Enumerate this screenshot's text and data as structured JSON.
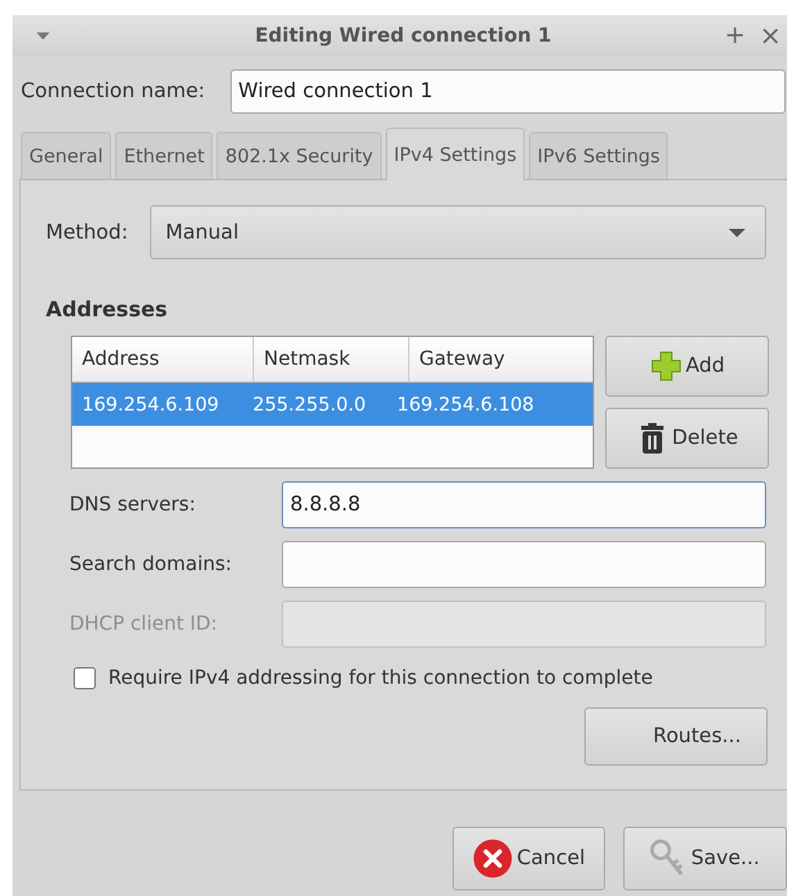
{
  "window": {
    "title": "Editing Wired connection 1",
    "controls": [
      {
        "kind": "maximize",
        "glyph": "+"
      },
      {
        "kind": "close",
        "glyph": "×"
      }
    ]
  },
  "connection_name": {
    "label": "Connection name:",
    "value": "Wired connection 1"
  },
  "tabs": [
    {
      "label": "General",
      "selected": false
    },
    {
      "label": "Ethernet",
      "selected": false
    },
    {
      "label": "802.1x Security",
      "selected": false
    },
    {
      "label": "IPv4 Settings",
      "selected": true
    },
    {
      "label": "IPv6 Settings",
      "selected": false
    }
  ],
  "method": {
    "label": "Method:",
    "value": "Manual"
  },
  "addresses": {
    "heading": "Addresses",
    "columns": [
      "Address",
      "Netmask",
      "Gateway"
    ],
    "rows": [
      {
        "cells": [
          "169.254.6.109",
          "255.255.0.0",
          "169.254.6.108"
        ],
        "selected": true
      }
    ],
    "buttons": [
      {
        "kind": "add",
        "label": "Add"
      },
      {
        "kind": "delete",
        "label": "Delete"
      }
    ]
  },
  "fields": [
    {
      "label": "DNS servers:",
      "value": "8.8.8.8",
      "disabled": false,
      "focused": true
    },
    {
      "label": "Search domains:",
      "disabled": false,
      "focused": false
    },
    {
      "label": "DHCP client ID:",
      "disabled": true,
      "focused": false
    }
  ],
  "require_checkbox": {
    "label": "Require IPv4 addressing for this connection to complete",
    "checked": false
  },
  "routes_button": "Routes...",
  "footer_buttons": [
    {
      "kind": "cancel",
      "label": "Cancel"
    },
    {
      "kind": "save",
      "label": "Save..."
    }
  ]
}
